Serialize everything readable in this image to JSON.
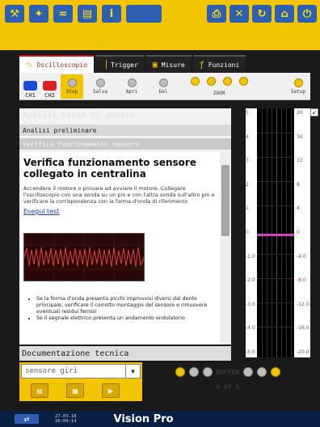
{
  "topbar": {
    "left_icons": [
      "wrench-icon",
      "tools-icon",
      "wifi-icon",
      "folder-icon",
      "info-icon"
    ],
    "logo": "",
    "right_icons": [
      "printer-icon",
      "wrench-cross-icon",
      "refresh-icon",
      "home-icon",
      "power-icon"
    ]
  },
  "tabs": [
    {
      "label": "Oscilloscopio",
      "active": true
    },
    {
      "label": "Trigger",
      "active": false
    },
    {
      "label": "Misure",
      "active": false
    },
    {
      "label": "Funzioni",
      "active": false
    }
  ],
  "toolbar": {
    "ch1": "CH1",
    "ch2": "CH2",
    "stop": "Stop",
    "salva": "Salva",
    "apri": "Apri",
    "del": "Del",
    "zoom": "ZOOM",
    "setup": "Setup"
  },
  "panel": {
    "header1": "Analisi cause di guasto",
    "header2": "Analisi preliminare",
    "header3": "Verifica funzionamento sensore",
    "doc_title": "Verifica funzionamento sensore collegato in centralina",
    "doc_text": "Accendere il motore o provare ad avviare il motore. Collegare l'oscilloscopio con una sonda su un pin e con l'altra sonda sull'altro pin e verificare la corrispondenza con la forma d'onda di riferimento",
    "doc_link": "Esegui test",
    "bullets": [
      "Se la forma d'onda presenta picchi improvvisi diversi dal dente principale, verificare il corretto montaggio del sensore e rimuovere eventuali residui ferrosi",
      "Se il segnale elettrico presenta un andamento ondulatorio"
    ],
    "doc_bar": "Documentazione tecnica",
    "select_value": "sensore giri"
  },
  "buffer": {
    "label": "BUFFER",
    "count": "0 of 0"
  },
  "graph": {
    "left_scale": [
      "5",
      "4",
      "3",
      "2",
      "1",
      "0",
      "-1.0",
      "-2.0",
      "-3.0",
      "-4.0",
      "-5.0"
    ],
    "right_scale": [
      "20",
      "16",
      "12",
      "8",
      "4",
      "0",
      "-4.0",
      "-8.0",
      "-12.0",
      "-16.0",
      "-20.0"
    ],
    "corner": "↙"
  },
  "footer": {
    "date": "27.03.18",
    "time": "16:04:14",
    "brand": "Vision Pro"
  },
  "colors": {
    "accent": "#f2c500",
    "brand_blue": "#2f5fb0",
    "scale_red": "#c04040"
  }
}
